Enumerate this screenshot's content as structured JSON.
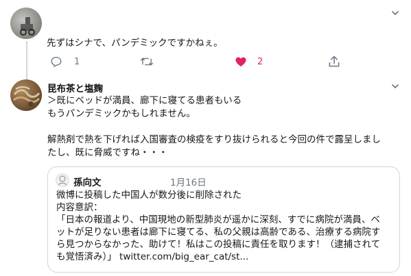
{
  "tweet1": {
    "text": "先ずはシナで、パンデミックですかねぇ。",
    "reply_count": "1",
    "retweet_count": "",
    "like_count": "2",
    "liked": true,
    "like_color": "#e0245e",
    "icon_color": "#657786"
  },
  "tweet2": {
    "author_name": "昆布茶と塩麹",
    "lines": [
      "＞既にベッドが満員、廊下に寝てる患者もいる",
      "もうパンデミックかもしれません。",
      "",
      "解熱剤で熱を下げれば入国審査の検疫をすり抜けられると今回の件で露呈しまし",
      "たし、既に脅威ですね・・・"
    ]
  },
  "quoted": {
    "author_name": "孫向文",
    "date": "1月16日",
    "lines": [
      "微博に投稿した中国人が数分後に削除された",
      "内容意訳：",
      "「日本の報道より、中国現地の新型肺炎が遥かに深刻、すでに病院が満員、ベ",
      "ットが足りない患者は廊下に寝てる、私の父親は高齢である、治療する病院す",
      "ら見つからなかった、助けて！私はこの投稿に責任を取ります！（逮捕されて",
      "も覚悟済み）」 twitter.com/big_ear_cat/st..."
    ]
  }
}
